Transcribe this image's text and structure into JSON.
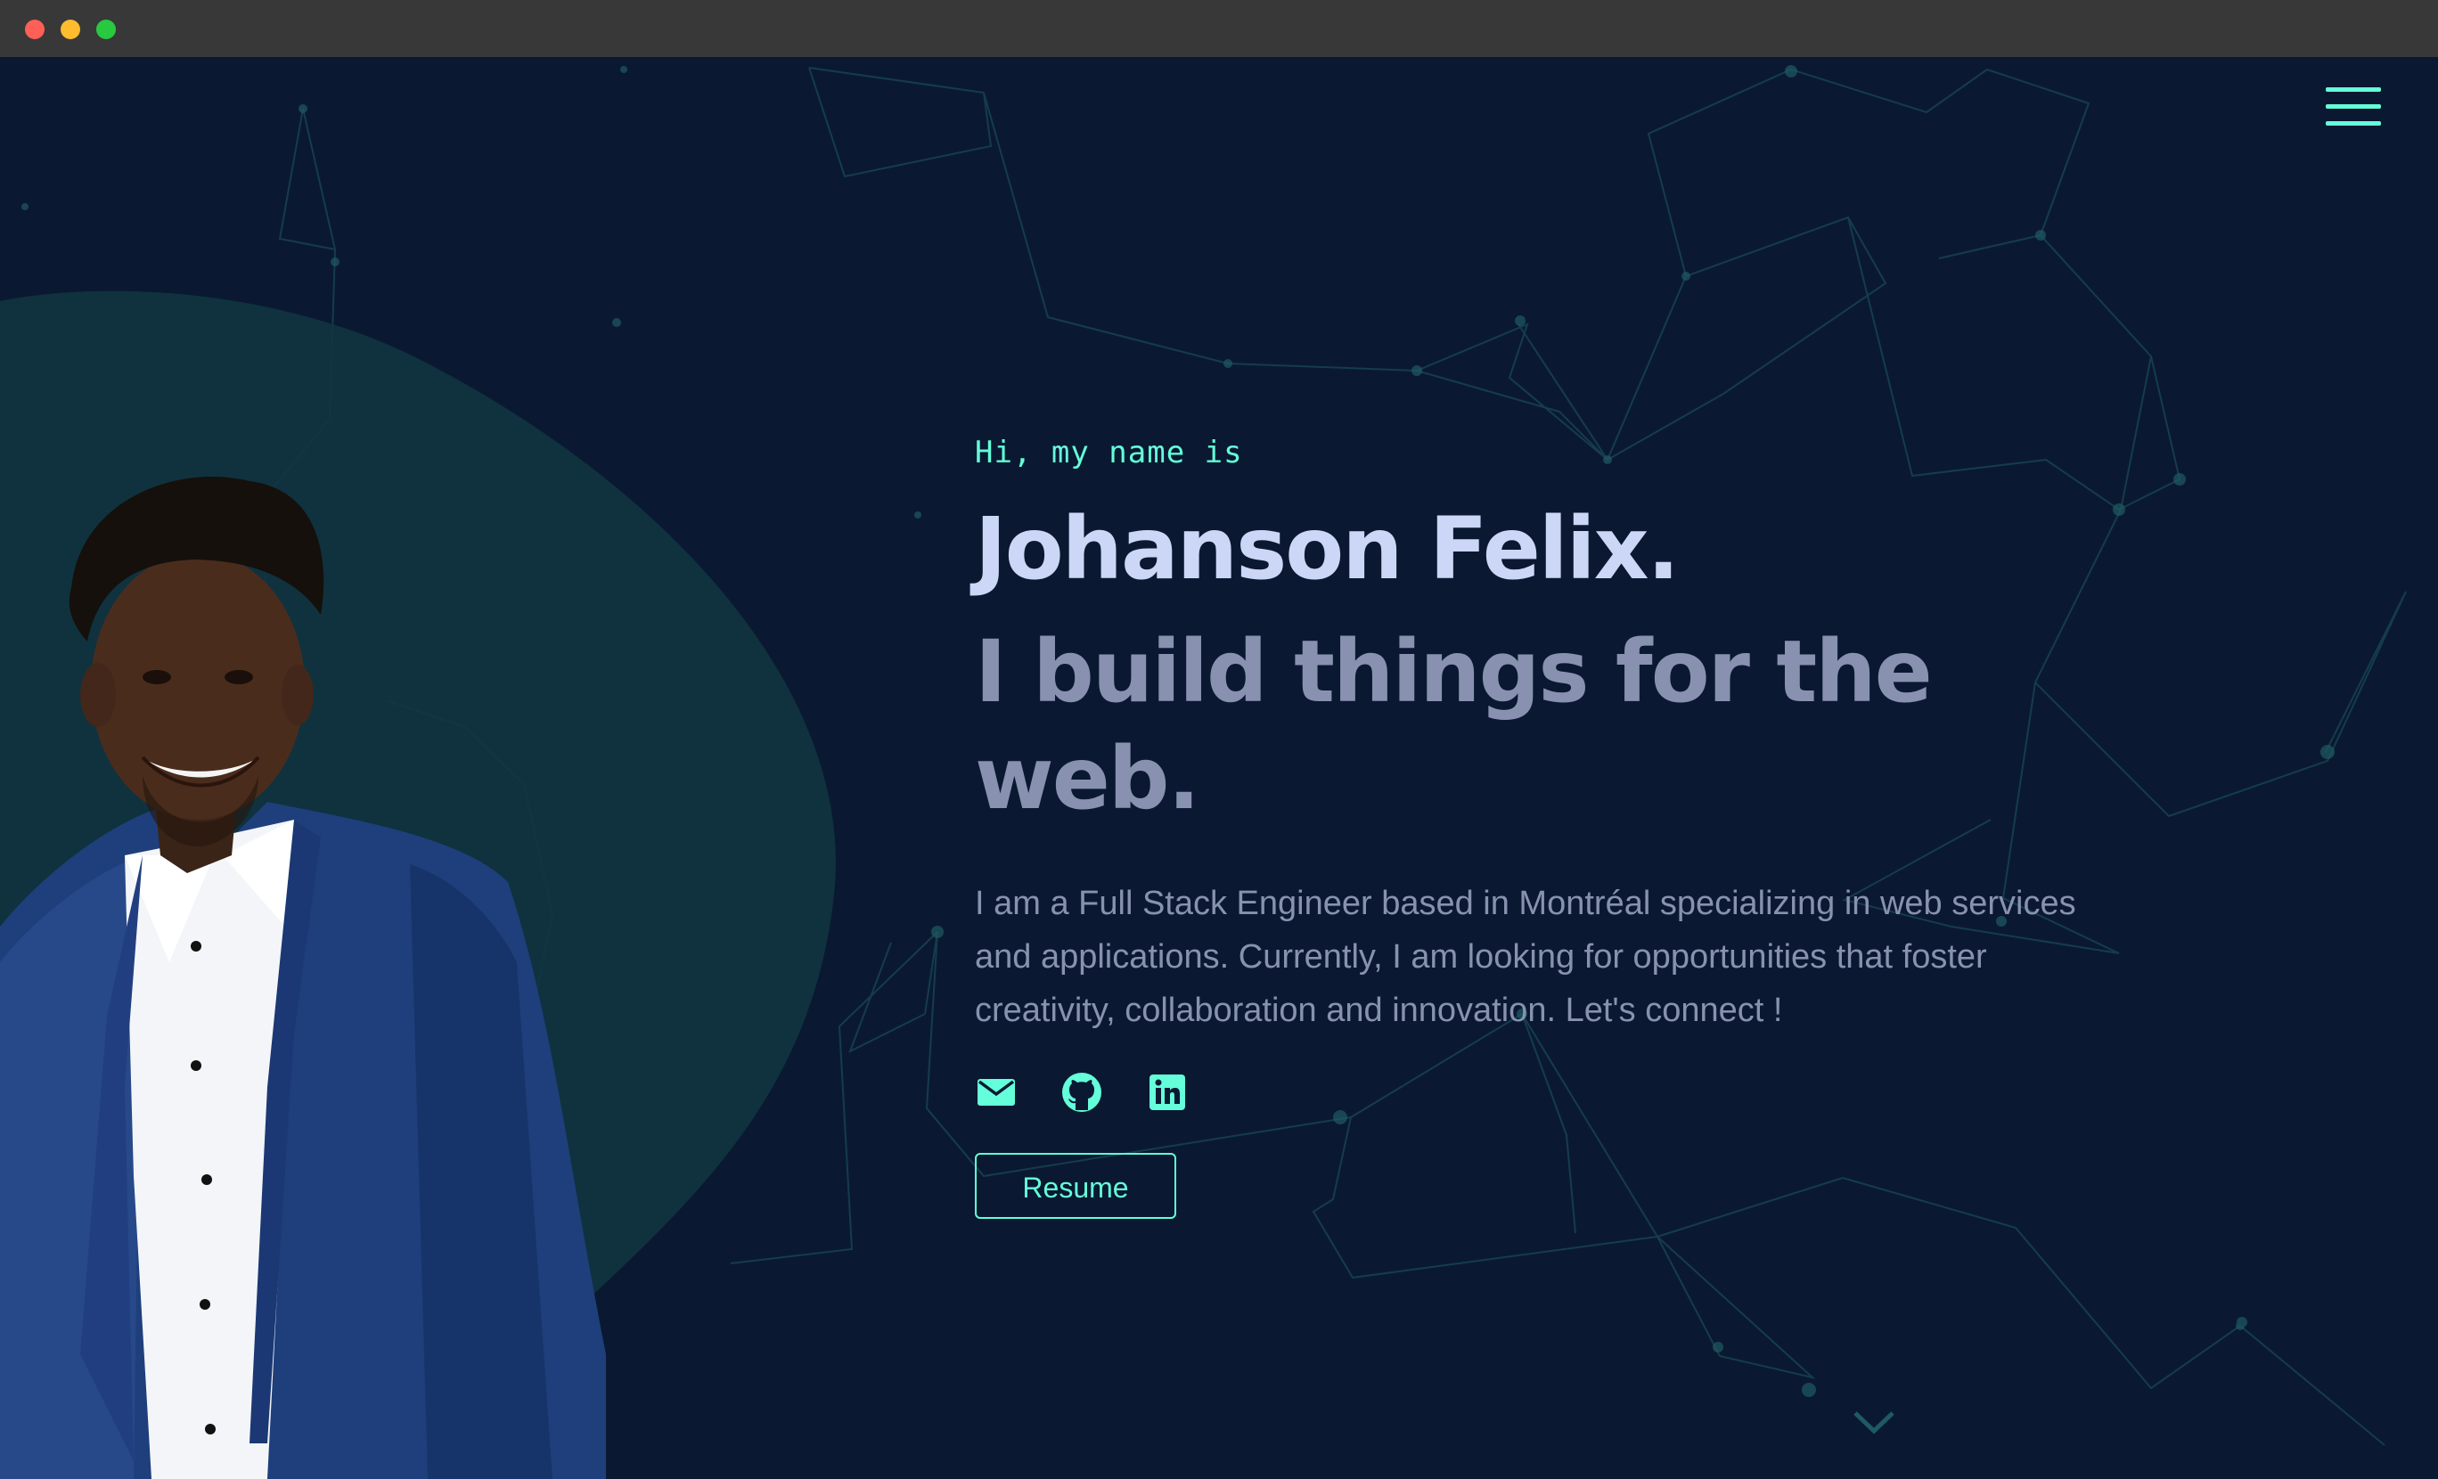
{
  "window": {
    "controls": [
      "close",
      "minimize",
      "zoom"
    ]
  },
  "nav": {
    "menu_icon": "hamburger-menu-icon"
  },
  "hero": {
    "greeting": "Hi, my name is",
    "name": "Johanson Felix.",
    "tagline": "I build things for the web.",
    "bio": "I am a Full Stack Engineer based in Montréal specializing in web services and applications. Currently, I am looking for opportunities that foster creativity, collaboration and innovation. Let's connect !",
    "socials": [
      {
        "icon": "email-icon"
      },
      {
        "icon": "github-icon"
      },
      {
        "icon": "linkedin-icon"
      }
    ],
    "resume_label": "Resume",
    "scroll_icon": "chevron-down-icon"
  },
  "colors": {
    "background": "#0a1931",
    "accent": "#64ffda",
    "heading": "#ccd6f6",
    "muted": "#8892b0",
    "blob": "#0f3540"
  }
}
